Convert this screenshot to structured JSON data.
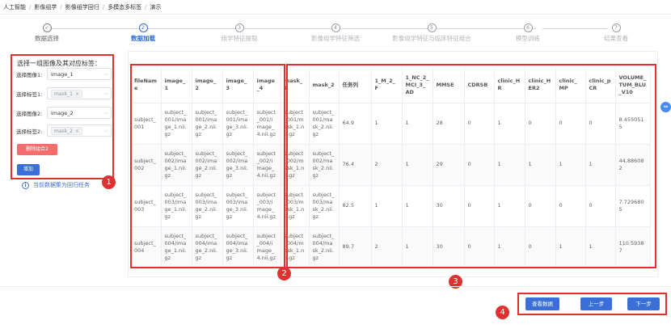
{
  "breadcrumb": [
    "人工智能",
    "影像组学",
    "影像组学回归",
    "多模态多标签",
    "演示"
  ],
  "steps": [
    {
      "num": "✓",
      "label": "数据选择",
      "state": "done"
    },
    {
      "num": "2",
      "label": "数据加载",
      "state": "active"
    },
    {
      "num": "3",
      "label": "组学特征提取",
      "state": "todo"
    },
    {
      "num": "4",
      "label": "影像组学特征筛选",
      "state": "todo"
    },
    {
      "num": "5",
      "label": "影像组学特征与临床特征组合",
      "state": "todo"
    },
    {
      "num": "6",
      "label": "模型训练",
      "state": "todo"
    },
    {
      "num": "7",
      "label": "结果查看",
      "state": "todo"
    }
  ],
  "left_panel": {
    "title": "选择一组图像及其对应标签：",
    "image1_label": "选择图像1:",
    "image1_value": "image_1",
    "label1_label": "选择标签1:",
    "label1_tag": "mask_1",
    "image2_label": "选择图像2:",
    "image2_value": "image_2",
    "label2_label": "选择标签2:",
    "label2_tag": "mask_2",
    "delete_button": "删除组合2",
    "add_button": "增加"
  },
  "hint": "当前数据集为回归任务",
  "table": {
    "columns": [
      "fileName",
      "image_1",
      "image_2",
      "image_3",
      "image_4",
      "mask_1",
      "mask_2",
      "任务列",
      "1_M_2_F",
      "1_NC_2_MCI_3_AD",
      "MMSE",
      "CDRSB",
      "clinic_HR",
      "clinic_HER2",
      "clinic_MP",
      "clinic_pCR",
      "VOLUME_TUM_BLU_V10"
    ],
    "rows": [
      [
        "subject_001",
        "subject_001/image_1.nii.gz",
        "subject_001/image_2.nii.gz",
        "subject_001/image_3.nii.gz",
        "subject_001/image_4.nii.gz",
        "subject_001/mask_1.nii.gz",
        "subject_001/mask_2.nii.gz",
        "64.9",
        "1",
        "1",
        "28",
        "0",
        "1",
        "0",
        "0",
        "0",
        "8.4550515"
      ],
      [
        "subject_002",
        "subject_002/image_1.nii.gz",
        "subject_002/image_2.nii.gz",
        "subject_002/image_3.nii.gz",
        "subject_002/image_4.nii.gz",
        "subject_002/mask_1.nii.gz",
        "subject_002/mask_2.nii.gz",
        "76.4",
        "2",
        "1",
        "29",
        "0",
        "1",
        "1",
        "1",
        "1",
        "44.886082"
      ],
      [
        "subject_003",
        "subject_003/image_1.nii.gz",
        "subject_003/image_2.nii.gz",
        "subject_003/image_3.nii.gz",
        "subject_003/image_4.nii.gz",
        "subject_003/mask_1.nii.gz",
        "subject_003/mask_2.nii.gz",
        "82.5",
        "1",
        "1",
        "30",
        "0",
        "1",
        "0",
        "0",
        "0",
        "7.7296805"
      ],
      [
        "subject_004",
        "subject_004/image_1.nii.gz",
        "subject_004/image_2.nii.gz",
        "subject_004/image_3.nii.gz",
        "subject_004/image_4.nii.gz",
        "subject_004/mask_1.nii.gz",
        "subject_004/mask_2.nii.gz",
        "89.7",
        "2",
        "1",
        "30",
        "0",
        "1",
        "0",
        "1",
        "1",
        "110.59387"
      ]
    ]
  },
  "markers": [
    "1",
    "2",
    "3",
    "4"
  ],
  "footer": {
    "view_data": "查看数据",
    "prev": "上一步",
    "next": "下一步"
  },
  "scroll_handle_icon": "⇔"
}
